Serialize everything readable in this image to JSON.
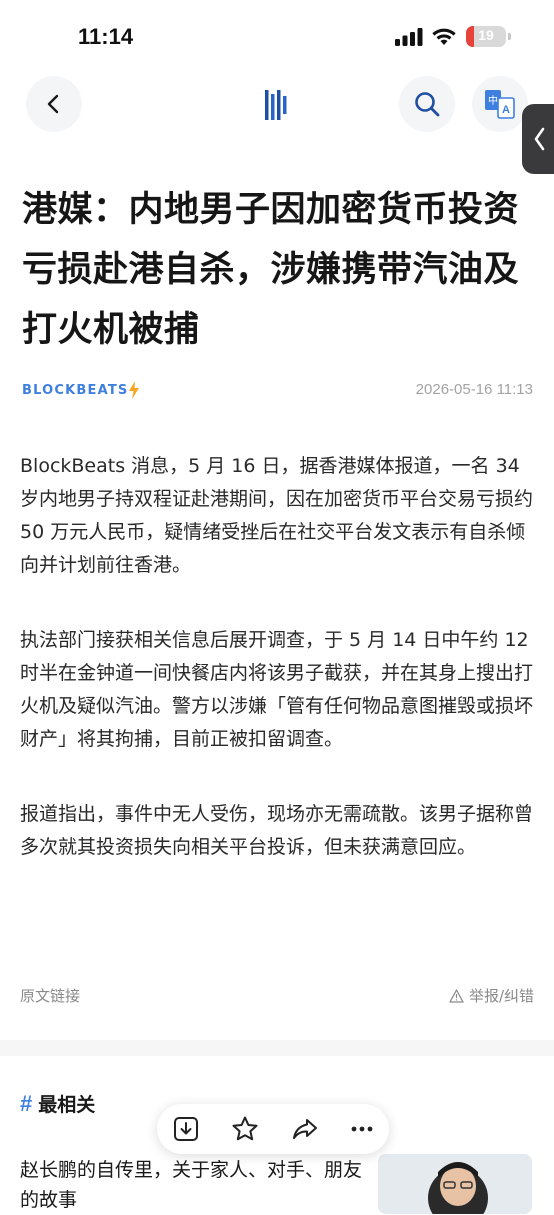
{
  "status_bar": {
    "time": "11:14",
    "battery": "19",
    "battery_level": 0.19
  },
  "nav": {
    "back_icon": "chevron-left-icon",
    "logo_icon": "blockbeats-mark-icon",
    "search_icon": "search-icon",
    "translate_icon": "translate-icon",
    "translate_glyphs": [
      "中",
      "A"
    ],
    "side_tab_icon": "chevron-left-icon"
  },
  "article": {
    "title": "港媒：内地男子因加密货币投资亏损赴港自杀，涉嫌携带汽油及打火机被捕",
    "source": "BLOCKBEATS",
    "timestamp": "2026-05-16 11:13",
    "paragraphs": [
      "BlockBeats 消息，5 月 16 日，据香港媒体报道，一名 34 岁内地男子持双程证赴港期间，因在加密货币平台交易亏损约 50 万元人民币，疑情绪受挫后在社交平台发文表示有自杀倾向并计划前往香港。",
      "执法部门接获相关信息后展开调查，于 5 月 14 日中午约 12 时半在金钟道一间快餐店内将该男子截获，并在其身上搜出打火机及疑似汽油。警方以涉嫌「管有任何物品意图摧毁或损坏财产」将其拘捕，目前正被扣留调查。",
      "报道指出，事件中无人受伤，现场亦无需疏散。该男子据称曾多次就其投资损失向相关平台投诉，但未获满意回应。"
    ],
    "original_link": "原文链接",
    "report": "举报/纠错"
  },
  "related": {
    "hash": "#",
    "heading": "最相关",
    "item_title": "赵长鹏的自传里，关于家人、对手、朋友的故事"
  },
  "toolbar": {
    "icons": [
      "download-icon",
      "star-icon",
      "share-icon",
      "more-icon"
    ]
  },
  "colors": {
    "accent": "#3f7fe0",
    "battery_low": "#e6443b"
  }
}
